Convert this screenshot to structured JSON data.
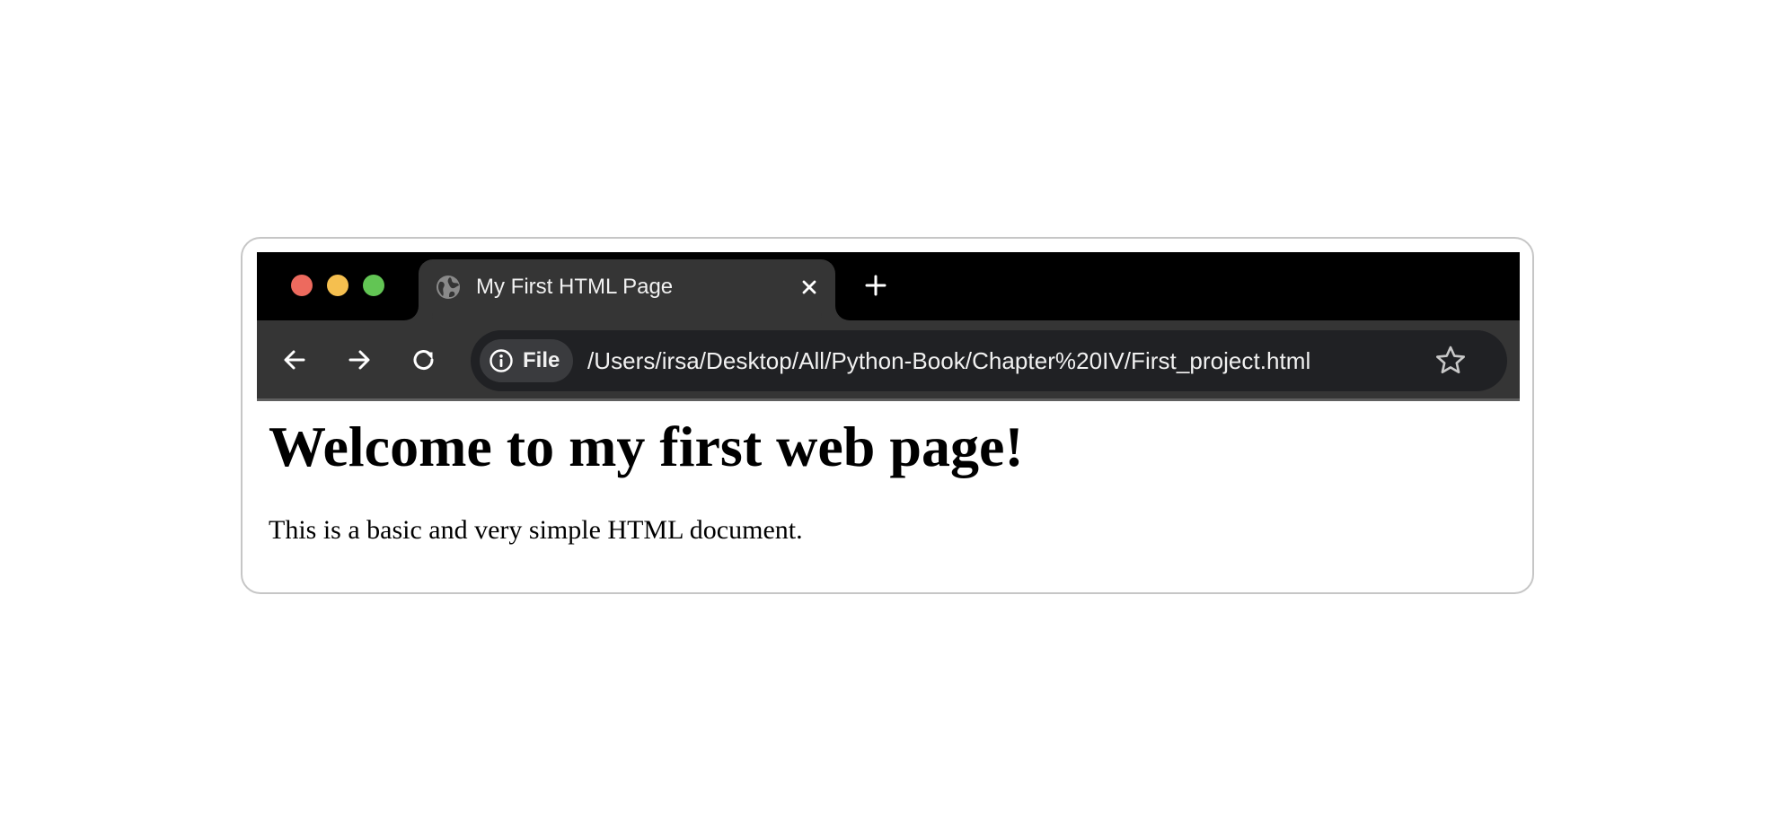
{
  "browser": {
    "tab": {
      "title": "My First HTML Page",
      "favicon_icon": "globe-icon",
      "close_icon": "close-icon"
    },
    "new_tab_icon": "plus-icon",
    "nav": {
      "back_icon": "arrow-left-icon",
      "forward_icon": "arrow-right-icon",
      "reload_icon": "reload-icon"
    },
    "address_bar": {
      "chip_icon": "info-icon",
      "chip_label": "File",
      "url": "/Users/irsa/Desktop/All/Python-Book/Chapter%20IV/First_project.html",
      "bookmark_icon": "star-icon"
    },
    "window_controls": {
      "close_color": "#ed6a5e",
      "minimize_color": "#f5bf4f",
      "maximize_color": "#62c554"
    }
  },
  "page": {
    "heading": "Welcome to my first web page!",
    "paragraph": "This is a basic and very simple HTML document."
  }
}
